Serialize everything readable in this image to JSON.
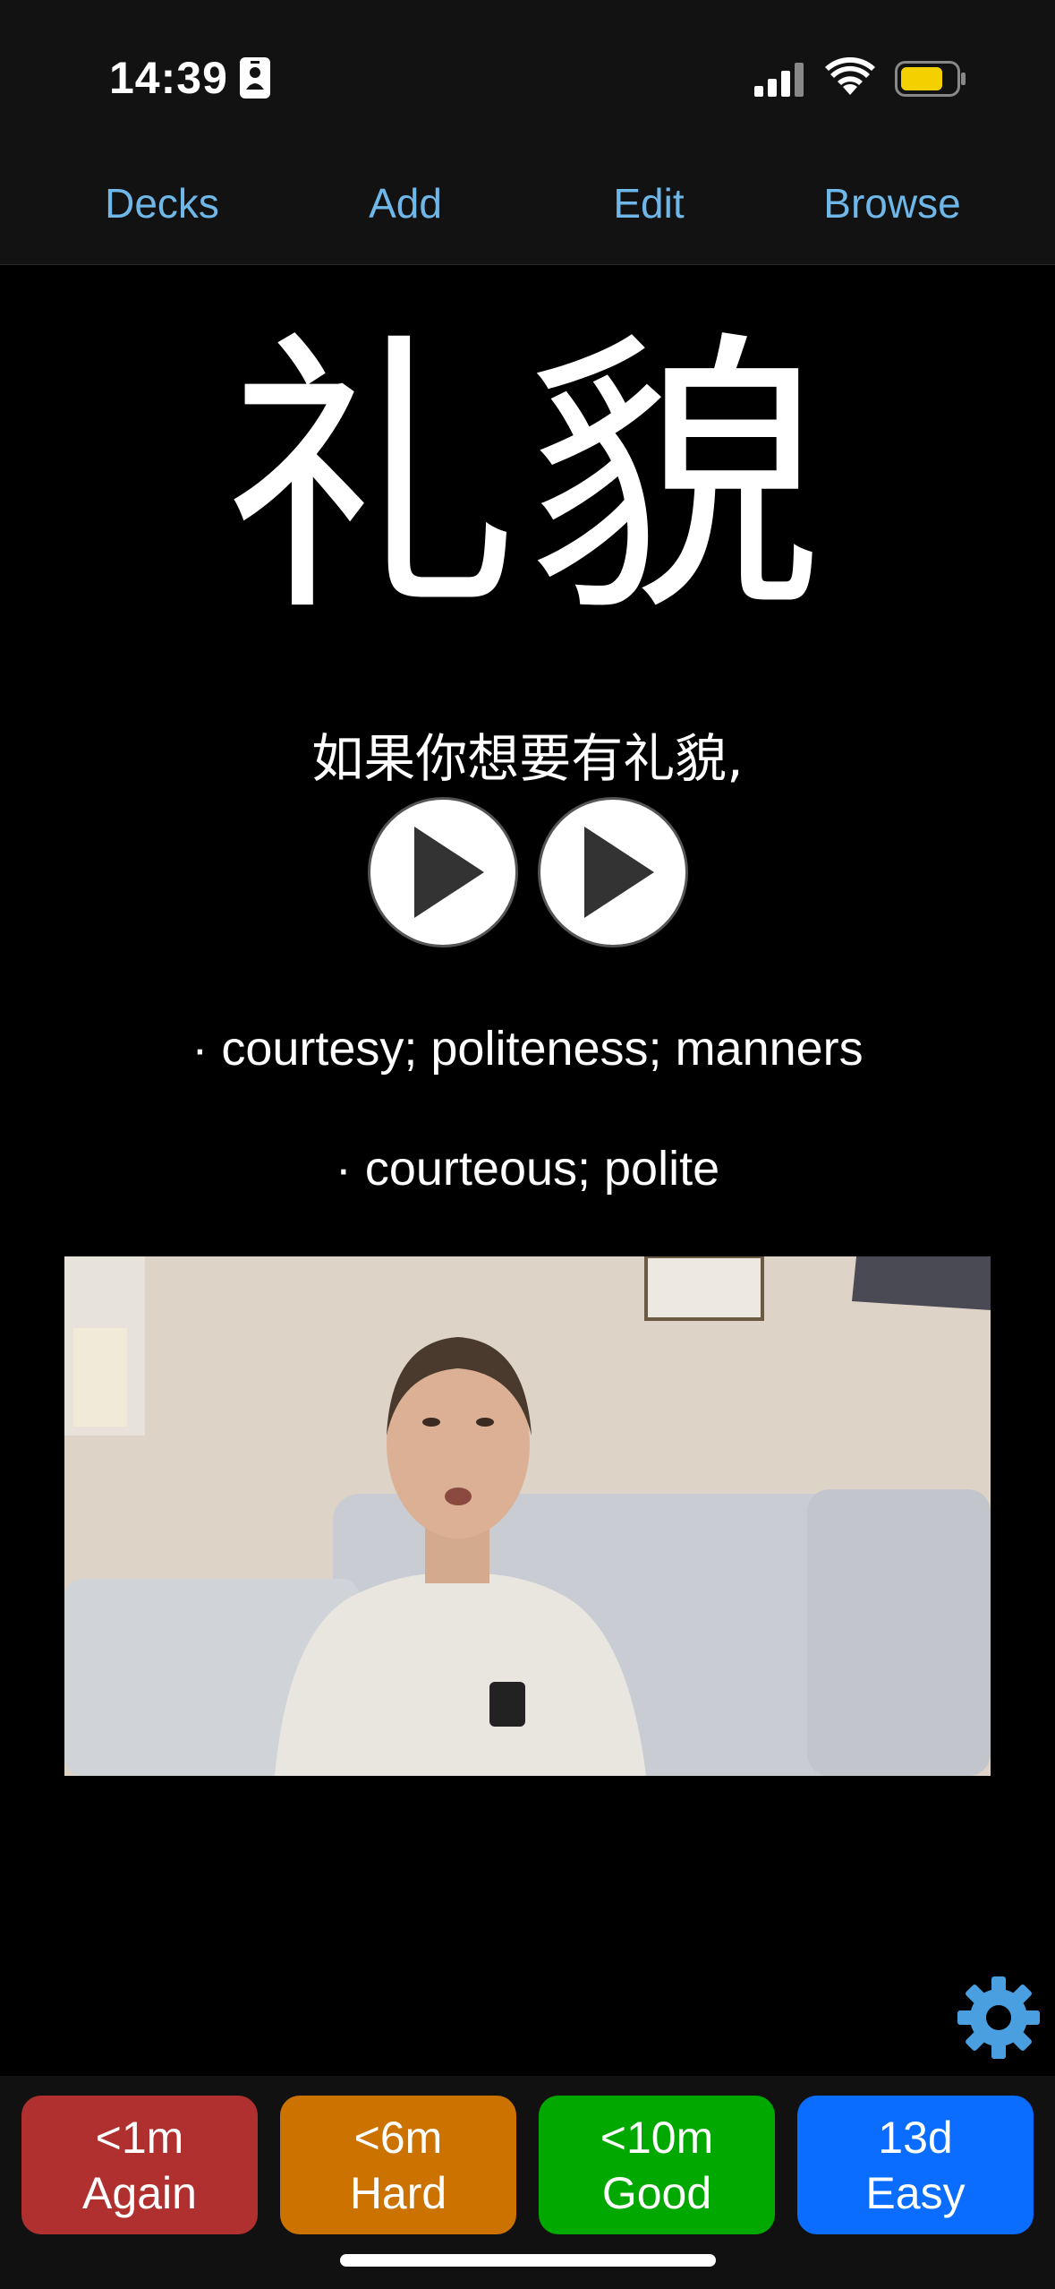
{
  "status_bar": {
    "time": "14:39",
    "icons": [
      "id-card-icon",
      "cellular-signal-icon",
      "wifi-icon",
      "battery-icon"
    ],
    "battery_color": "#f5d000"
  },
  "nav": {
    "items": [
      {
        "label": "Decks"
      },
      {
        "label": "Add"
      },
      {
        "label": "Edit"
      },
      {
        "label": "Browse"
      }
    ],
    "color": "#6fb7e8"
  },
  "card": {
    "headword": "礼貌",
    "sentence": "如果你想要有礼貌,",
    "audio_buttons": [
      "play-icon",
      "play-icon"
    ],
    "definitions": [
      "· courtesy; politeness; manners",
      "· courteous; polite"
    ],
    "video": {
      "content": "woman speaking on a couch"
    }
  },
  "settings": {
    "icon": "gear-icon",
    "color": "#4a9fe0"
  },
  "answers": [
    {
      "interval": "<1m",
      "label": "Again",
      "color": "#b03030"
    },
    {
      "interval": "<6m",
      "label": "Hard",
      "color": "#cc7200"
    },
    {
      "interval": "<10m",
      "label": "Good",
      "color": "#00a800"
    },
    {
      "interval": "13d",
      "label": "Easy",
      "color": "#0a6dff"
    }
  ]
}
